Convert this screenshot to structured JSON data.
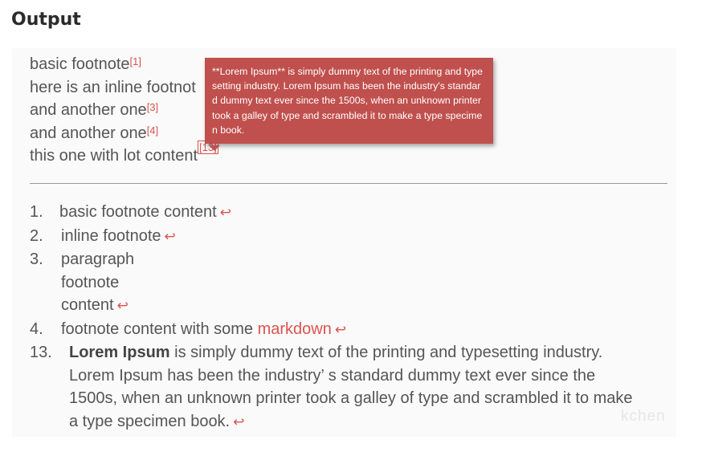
{
  "heading": "Output",
  "lines": {
    "l1_text": "basic footnote",
    "l1_ref": "[1]",
    "l2_text": "here is an inline footnot",
    "l3_text": "and another one",
    "l3_ref": "[3]",
    "l4_text": "and another one",
    "l4_ref": "[4]",
    "l5_text": "this one with lot content",
    "l5_ref": "[13]"
  },
  "tooltip": {
    "text": "**Lorem Ipsum** is simply dummy text of the printing and typesetting industry. Lorem Ipsum has been the industry's standard dummy text ever since the 1500s, when an unknown printer took a galley of type and scrambled it to make a type specimen book."
  },
  "footnotes": {
    "back_glyph": "↩",
    "f1_num": "1.",
    "f1_text": "basic footnote content",
    "f2_num": "2.",
    "f2_text": "inline footnote",
    "f3_num": "3.",
    "f3_line1": "paragraph",
    "f3_line2": "footnote",
    "f3_line3": "content",
    "f4_num": "4.",
    "f4_text": "footnote content with some",
    "f4_link": "markdown",
    "f13_num": "13.",
    "f13_bold": "Lorem Ipsum",
    "f13_line1_rest": " is simply dummy text of the printing and typesetting industry.",
    "f13_line2": "Lorem Ipsum has been the industry’ s standard dummy text ever since the",
    "f13_line3": "1500s, when an unknown printer took a galley of type and scrambled it to make",
    "f13_line4": "a type specimen book."
  },
  "watermark": "kchen",
  "colors": {
    "accent": "#d9534f",
    "tooltip_bg": "#c0504d",
    "text": "#555555"
  }
}
